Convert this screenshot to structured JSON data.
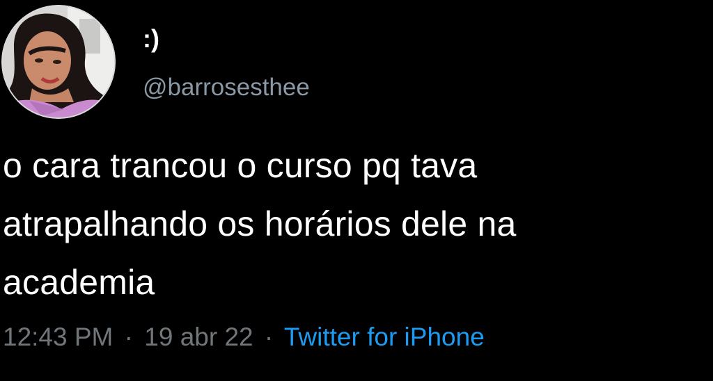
{
  "tweet": {
    "display_name": ":)",
    "handle": "@barrosesthee",
    "text_lines": [
      "o cara trancou o curso pq tava",
      "atrapalhando os horários dele na",
      "academia"
    ],
    "time": "12:43 PM",
    "date": "19 abr 22",
    "separator": "·",
    "source": "Twitter for iPhone"
  },
  "colors": {
    "background": "#000000",
    "text": "#ffffff",
    "secondary": "#71767b",
    "link": "#1d9bf0",
    "avatar_border": "#d9d9d9"
  },
  "icons": {
    "avatar": "profile-photo"
  }
}
